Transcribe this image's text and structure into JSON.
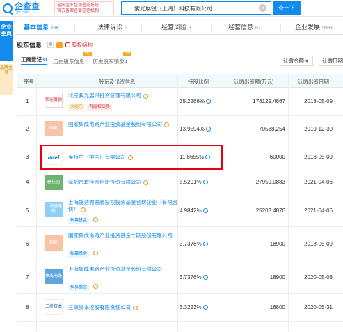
{
  "header": {
    "logo_main": "企查查",
    "logo_sub": "Qcc.com",
    "promo_line1": "全国企业信用查询系统",
    "promo_line2": "官方备案企业征信机构",
    "search_value": "紫光展锐（上海）科技有限公司",
    "search_button": "查一下"
  },
  "side": {
    "main": "企业主页",
    "sub": "品牌主页"
  },
  "tabs": [
    {
      "label": "基本信息",
      "count": "198"
    },
    {
      "label": "法律诉讼",
      "count": "9"
    },
    {
      "label": "经营风险",
      "count": "3"
    },
    {
      "label": "经营信息",
      "count": "67"
    },
    {
      "label": "企业发展",
      "count": "999+"
    }
  ],
  "section": {
    "title": "股东信息",
    "equity_link": "股权结构",
    "subtabs": [
      {
        "label": "工商登记",
        "count": "31",
        "vip": ""
      },
      {
        "label": "历史股东信息",
        "count": "1",
        "vip": "VIP"
      },
      {
        "label": "历史股东镜像",
        "count": "4",
        "vip": "VIP"
      }
    ],
    "filter": "认缴金额",
    "filter2": "认缴日期"
  },
  "table": {
    "headers": [
      "序号",
      "股东及出资信息",
      "持股比例",
      "认缴出资额(万元)",
      "认缴出资日期"
    ],
    "rows": [
      {
        "no": "1",
        "logo": "紫光展锐",
        "name": "北京紫光展讯投资管理有限公司",
        "tags": [
          "大股东",
          "有股权出质"
        ],
        "pct": "35.2266%",
        "cap": "178129.4867",
        "date": "2018-05-09"
      },
      {
        "no": "2",
        "logo": "国家",
        "name": "国家集成电路产业投资基金股份有限公司",
        "tags": [],
        "pct": "13.9594%",
        "cap": "70588.254",
        "date": "2019-12-30"
      },
      {
        "no": "3",
        "logo": "intel",
        "name": "英特尔（中国）有限公司",
        "tags": [],
        "pct": "11.8655%",
        "cap": "60000",
        "date": "2018-05-09"
      },
      {
        "no": "4",
        "logo": "碧桂园",
        "name": "深圳市碧桂园创新投资有限公司",
        "tags": [],
        "pct": "5.5291%",
        "cap": "27959.0883",
        "date": "2021-04-06"
      },
      {
        "no": "5",
        "logo": "上海盛迪微",
        "name": "上海盛迪微融膳投权投资基金合伙企业（有限合伙）",
        "tags": [
          "私募基金"
        ],
        "pct": "4.9842%",
        "cap": "25203.4876",
        "date": "2021-04-06"
      },
      {
        "no": "6",
        "logo": "国家",
        "name": "国家集成电路产业投资基金二期股份有限公司",
        "tags": [
          "私募基金"
        ],
        "pct": "3.7376%",
        "cap": "18900",
        "date": "2018-05-09"
      },
      {
        "no": "7",
        "logo": "集成电路",
        "name": "上海集成电路产业投资基金股份有限公司",
        "tags": [
          "私募基金"
        ],
        "pct": "3.7376%",
        "cap": "18900",
        "date": "2020-05-08"
      },
      {
        "no": "8",
        "logo": "三峡资本",
        "name": "三峡资本控股有限责任公司",
        "tags": [],
        "pct": "3.3223%",
        "cap": "16800",
        "date": "2020-05-31"
      }
    ]
  }
}
